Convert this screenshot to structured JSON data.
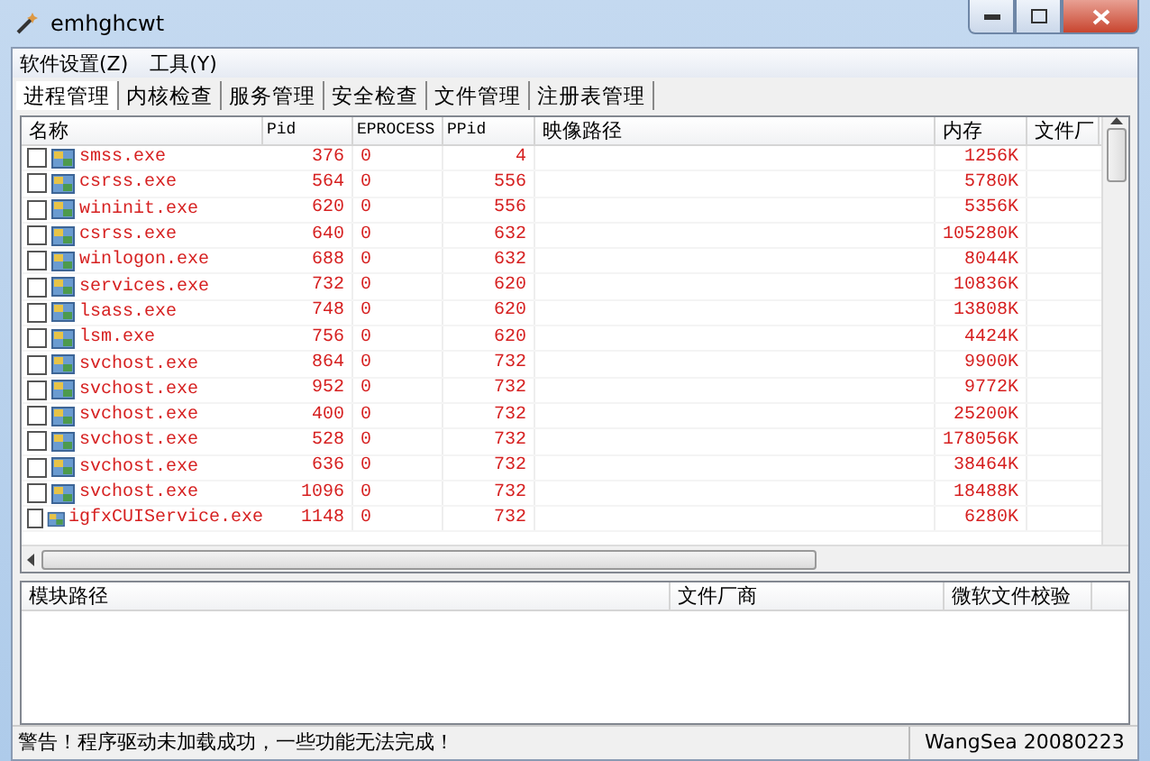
{
  "window": {
    "title": "emhghcwt"
  },
  "menu": [
    "软件设置(Z)",
    "工具(Y)"
  ],
  "tabs": [
    {
      "label": "进程管理",
      "selected": true
    },
    {
      "label": "内核检查",
      "selected": false
    },
    {
      "label": "服务管理",
      "selected": false
    },
    {
      "label": "安全检查",
      "selected": false
    },
    {
      "label": "文件管理",
      "selected": false
    },
    {
      "label": "注册表管理",
      "selected": false
    }
  ],
  "table": {
    "columns": [
      "名称",
      "Pid",
      "EPROCESS",
      "PPid",
      "映像路径",
      "内存",
      "文件厂"
    ],
    "rows": [
      {
        "checked": false,
        "name": "smss.exe",
        "pid": "376",
        "eprocess": "0",
        "ppid": "4",
        "memory": "1256K"
      },
      {
        "checked": false,
        "name": "csrss.exe",
        "pid": "564",
        "eprocess": "0",
        "ppid": "556",
        "memory": "5780K"
      },
      {
        "checked": false,
        "name": "wininit.exe",
        "pid": "620",
        "eprocess": "0",
        "ppid": "556",
        "memory": "5356K"
      },
      {
        "checked": false,
        "name": "csrss.exe",
        "pid": "640",
        "eprocess": "0",
        "ppid": "632",
        "memory": "105280K"
      },
      {
        "checked": false,
        "name": "winlogon.exe",
        "pid": "688",
        "eprocess": "0",
        "ppid": "632",
        "memory": "8044K"
      },
      {
        "checked": false,
        "name": "services.exe",
        "pid": "732",
        "eprocess": "0",
        "ppid": "620",
        "memory": "10836K"
      },
      {
        "checked": false,
        "name": "lsass.exe",
        "pid": "748",
        "eprocess": "0",
        "ppid": "620",
        "memory": "13808K"
      },
      {
        "checked": false,
        "name": "lsm.exe",
        "pid": "756",
        "eprocess": "0",
        "ppid": "620",
        "memory": "4424K"
      },
      {
        "checked": false,
        "name": "svchost.exe",
        "pid": "864",
        "eprocess": "0",
        "ppid": "732",
        "memory": "9900K"
      },
      {
        "checked": false,
        "name": "svchost.exe",
        "pid": "952",
        "eprocess": "0",
        "ppid": "732",
        "memory": "9772K"
      },
      {
        "checked": false,
        "name": "svchost.exe",
        "pid": "400",
        "eprocess": "0",
        "ppid": "732",
        "memory": "25200K"
      },
      {
        "checked": false,
        "name": "svchost.exe",
        "pid": "528",
        "eprocess": "0",
        "ppid": "732",
        "memory": "178056K"
      },
      {
        "checked": false,
        "name": "svchost.exe",
        "pid": "636",
        "eprocess": "0",
        "ppid": "732",
        "memory": "38464K"
      },
      {
        "checked": false,
        "name": "svchost.exe",
        "pid": "1096",
        "eprocess": "0",
        "ppid": "732",
        "memory": "18488K"
      },
      {
        "checked": false,
        "name": "igfxCUIService.exe",
        "pid": "1148",
        "eprocess": "0",
        "ppid": "732",
        "memory": "6280K"
      }
    ]
  },
  "modules": {
    "columns": [
      "模块路径",
      "文件厂商",
      "微软文件校验"
    ]
  },
  "status_bar": {
    "message": "警告！程序驱动未加载成功，一些功能无法完成！",
    "version": "WangSea 20080223"
  }
}
